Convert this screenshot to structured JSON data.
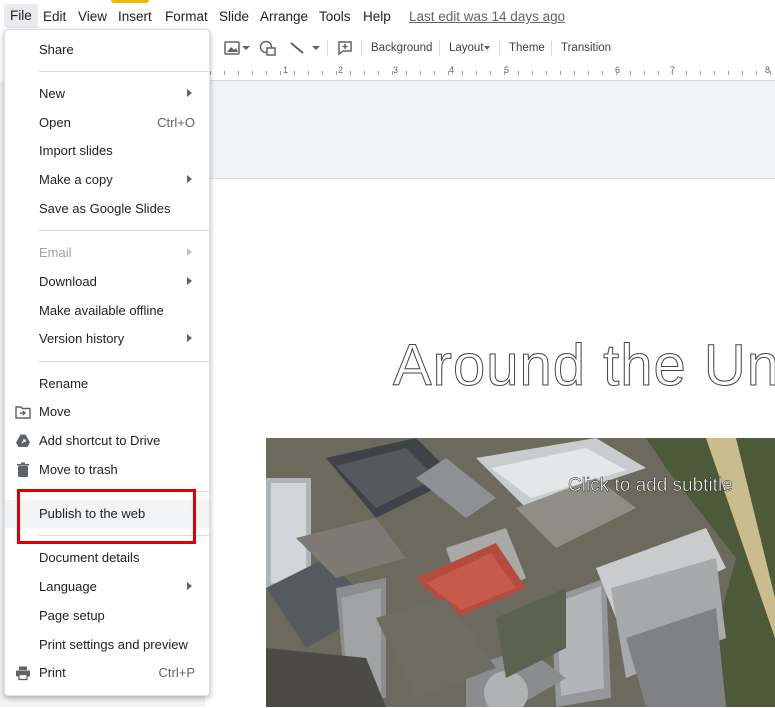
{
  "menubar": {
    "items": [
      "File",
      "Edit",
      "View",
      "Insert",
      "Format",
      "Slide",
      "Arrange",
      "Tools",
      "Help"
    ],
    "last_edit": "Last edit was 14 days ago"
  },
  "toolbar": {
    "background": "Background",
    "layout": "Layout",
    "theme": "Theme",
    "transition": "Transition"
  },
  "ruler": {
    "numbers": [
      "1",
      "2",
      "3",
      "4",
      "5",
      "6",
      "7",
      "8"
    ]
  },
  "slide": {
    "title": "Around the Uni",
    "subtitle": "Click to add subtitle"
  },
  "file_menu": {
    "share": "Share",
    "new": "New",
    "open": "Open",
    "open_shortcut": "Ctrl+O",
    "import_slides": "Import slides",
    "make_copy": "Make a copy",
    "save_as": "Save as Google Slides",
    "email": "Email",
    "download": "Download",
    "make_offline": "Make available offline",
    "version_history": "Version history",
    "rename": "Rename",
    "move": "Move",
    "add_shortcut": "Add shortcut to Drive",
    "move_trash": "Move to trash",
    "publish": "Publish to the web",
    "document_details": "Document details",
    "language": "Language",
    "page_setup": "Page setup",
    "print_settings": "Print settings and preview",
    "print": "Print",
    "print_shortcut": "Ctrl+P"
  },
  "colors": {
    "highlight_box": "#e00000",
    "accent": "#f4b400"
  }
}
